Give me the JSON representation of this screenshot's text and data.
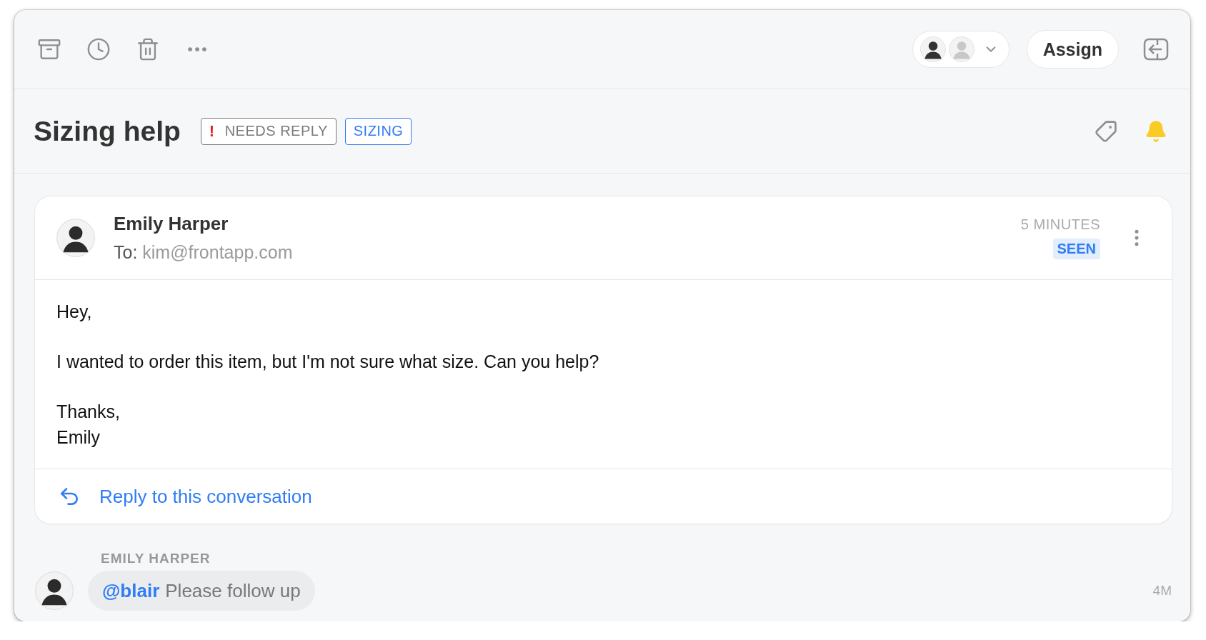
{
  "toolbar": {
    "assign_label": "Assign"
  },
  "conversation": {
    "title": "Sizing help",
    "subscribed": true,
    "tags": [
      {
        "mark": "!",
        "label": "NEEDS REPLY",
        "color": "#7a7a7a"
      },
      {
        "label": "SIZING",
        "color": "#2f7cf6"
      }
    ]
  },
  "message": {
    "sender": "Emily Harper",
    "to_label": "To:",
    "to_address": "kim@frontapp.com",
    "time": "5 MINUTES",
    "status": "SEEN",
    "paragraphs": [
      [
        "Hey,"
      ],
      [
        "I wanted to order this item, but I'm not sure what size. Can you help?"
      ],
      [
        "Thanks,",
        "Emily"
      ]
    ],
    "reply_link": "Reply to this conversation"
  },
  "comment": {
    "author": "EMILY HARPER",
    "mention": "@blair",
    "text": "Please follow up",
    "time": "4M"
  }
}
